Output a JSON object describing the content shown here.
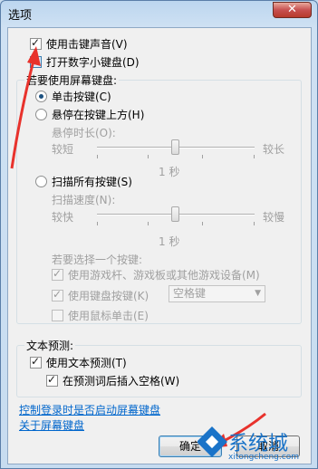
{
  "window": {
    "title": "选项",
    "close_label": "✕"
  },
  "options": {
    "key_sound": {
      "label": "使用击键声音(V)",
      "checked": true
    },
    "numpad": {
      "label": "打开数字小键盘(D)",
      "checked": false
    }
  },
  "use_keyboard": {
    "group_label": "若要使用屏幕键盘:",
    "click_keys": {
      "label": "单击按键(C)",
      "checked": true
    },
    "hover_keys": {
      "label": "悬停在按键上方(H)",
      "checked": false
    },
    "hover_duration": {
      "label": "悬停时长(O):",
      "min_label": "较短",
      "max_label": "较长",
      "value_label": "1 秒",
      "level": 0.5
    },
    "scan_keys": {
      "label": "扫描所有按键(S)",
      "checked": false
    },
    "scan_speed": {
      "label": "扫描速度(N):",
      "min_label": "较快",
      "max_label": "较慢",
      "value_label": "1 秒",
      "level": 0.5
    },
    "select_prompt": "若要选择一个按键:",
    "joystick": {
      "label": "使用游戏杆、游戏板或其他游戏设备(M)",
      "checked": true
    },
    "keyboard_key": {
      "label": "使用键盘按键(K)",
      "checked": true,
      "select_value": "空格键"
    },
    "mouse_click": {
      "label": "使用鼠标单击(E)",
      "checked": false
    }
  },
  "text_prediction": {
    "group_label": "文本预测:",
    "use_prediction": {
      "label": "使用文本预测(T)",
      "checked": true
    },
    "insert_space": {
      "label": "在预测词后插入空格(W)",
      "checked": true
    }
  },
  "links": {
    "control_login": "控制登录时是否启动屏幕键盘",
    "about": "关于屏幕键盘"
  },
  "buttons": {
    "ok": "确定",
    "cancel": "取消"
  },
  "watermark": {
    "text": "系统城",
    "url_text": "xitongcheng.com"
  },
  "colors": {
    "annotation_arrow": "#e8322c",
    "link": "#0066cc",
    "watermark_blue": "#1a73c8"
  }
}
